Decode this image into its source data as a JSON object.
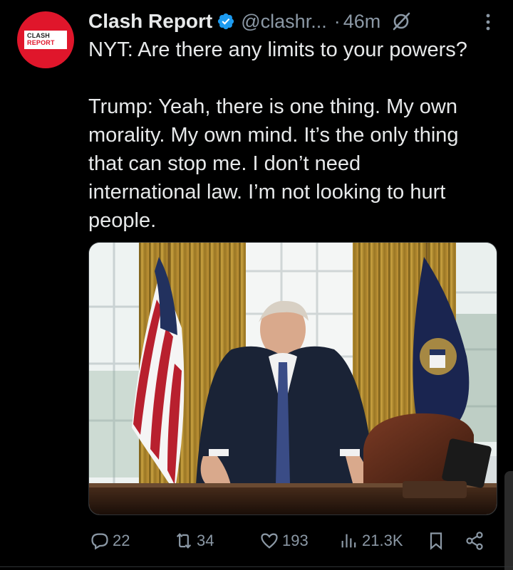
{
  "tweet": {
    "avatar": {
      "logo_line1": "CLASH",
      "logo_line2": "REPORT",
      "color": "#e0162b"
    },
    "display_name": "Clash Report",
    "handle": "@clashr...",
    "separator": "·",
    "time": "46m",
    "verified": true,
    "verified_color": "#1d9bf0",
    "text_lines": [
      "NYT: Are there any limits to your powers?",
      "",
      "Trump: Yeah, there is one thing. My own",
      "morality. My own mind. It’s the only thing",
      "that can stop me. I don’t need",
      "international law. I’m not looking to hurt",
      "people."
    ],
    "media": {
      "description_icon": "photo",
      "colors": {
        "curtain": "#b08a2e",
        "window": "#e8eef0",
        "suit": "#1a2336",
        "desk": "#2a1a12",
        "chair": "#5a2a1a"
      }
    },
    "actions": {
      "replies": "22",
      "reposts": "34",
      "likes": "193",
      "views": "21.3K"
    },
    "icons": {
      "grok": "grok-icon",
      "more": "more-icon",
      "reply": "reply-icon",
      "repost": "repost-icon",
      "like": "heart-icon",
      "views": "views-icon",
      "bookmark": "bookmark-icon",
      "share": "share-icon"
    }
  }
}
